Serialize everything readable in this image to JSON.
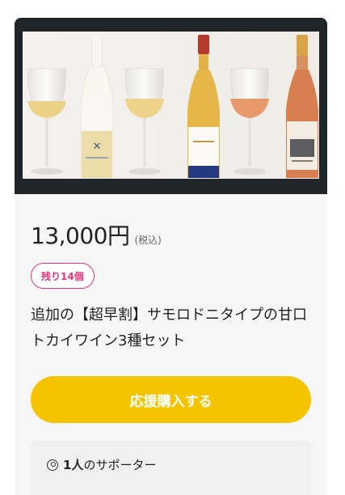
{
  "project": {
    "price": "13,000円",
    "tax_label": "(税込)",
    "stock_badge": "残り14個",
    "title": "追加の【超早割】サモロドニタイプの甘口トカイワイン3種セット",
    "buy_button_label": "応援購入する",
    "supporters_count": "1人",
    "supporters_suffix": "のサポーター"
  },
  "colors": {
    "accent_button": "#f5c400",
    "badge": "#e8347a",
    "photo_background": "#1f2528"
  }
}
